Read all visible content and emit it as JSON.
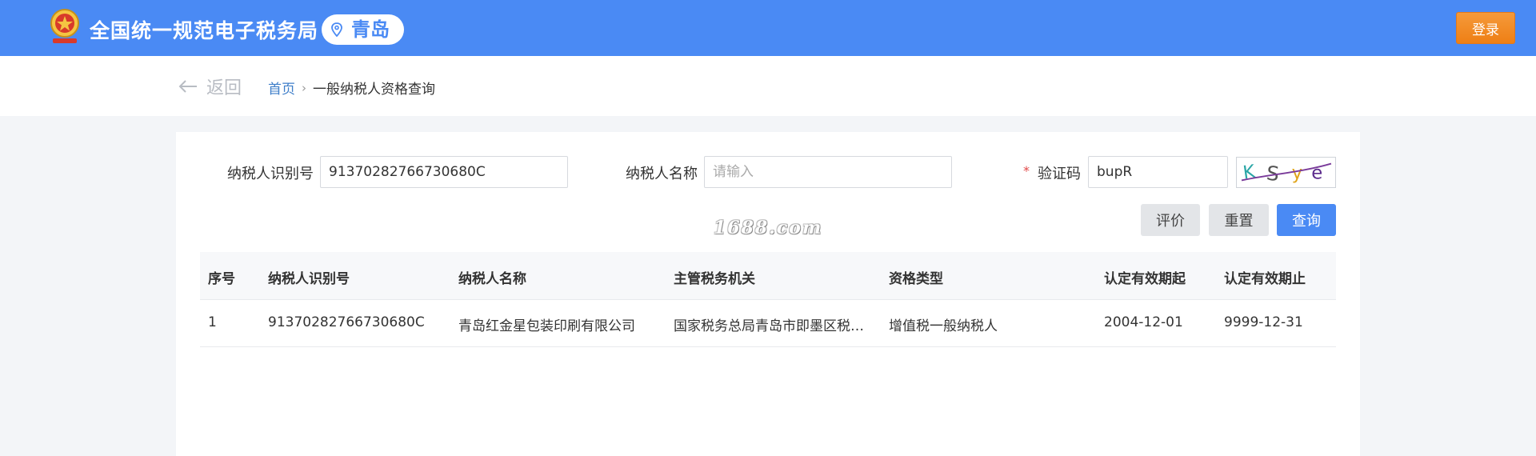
{
  "header": {
    "site_title": "全国统一规范电子税务局",
    "city": "青岛",
    "login_label": "登录",
    "brand_color": "#4a8af4",
    "login_color": "#ef8a22"
  },
  "nav": {
    "back_label": "返回",
    "breadcrumb": {
      "home": "首页",
      "separator": "›",
      "current": "一般纳税人资格查询"
    }
  },
  "form": {
    "taxpayer_id": {
      "label": "纳税人识别号",
      "value": "91370282766730680C"
    },
    "taxpayer_name": {
      "label": "纳税人名称",
      "value": "",
      "placeholder": "请输入"
    },
    "captcha": {
      "label": "验证码",
      "required_mark": "*",
      "value": "bupR",
      "image_text": [
        "K",
        "S",
        "y",
        "e"
      ]
    },
    "buttons": {
      "rate": "评价",
      "reset": "重置",
      "query": "查询"
    }
  },
  "watermark": "1688.com",
  "table": {
    "columns": [
      "序号",
      "纳税人识别号",
      "纳税人名称",
      "主管税务机关",
      "资格类型",
      "认定有效期起",
      "认定有效期止"
    ],
    "rows": [
      [
        "1",
        "91370282766730680C",
        "青岛红金星包装印刷有限公司",
        "国家税务总局青岛市即墨区税务局",
        "增值税一般纳税人",
        "2004-12-01",
        "9999-12-31"
      ]
    ]
  }
}
